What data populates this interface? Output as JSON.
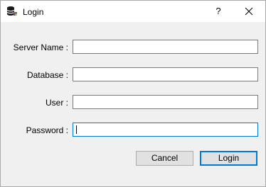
{
  "titlebar": {
    "title": "Login",
    "help_label": "?",
    "app_icon": "database-icon",
    "close_icon": "close-icon"
  },
  "form": {
    "server_name_label": "Server Name :",
    "server_name_value": "",
    "database_label": "Database :",
    "database_value": "",
    "user_label": "User :",
    "user_value": "",
    "password_label": "Password :",
    "password_value": ""
  },
  "buttons": {
    "cancel_label": "Cancel",
    "login_label": "Login"
  },
  "colors": {
    "focus_border": "#0078d7",
    "button_face": "#e1e1e1",
    "window_bg": "#f0f0f0"
  }
}
